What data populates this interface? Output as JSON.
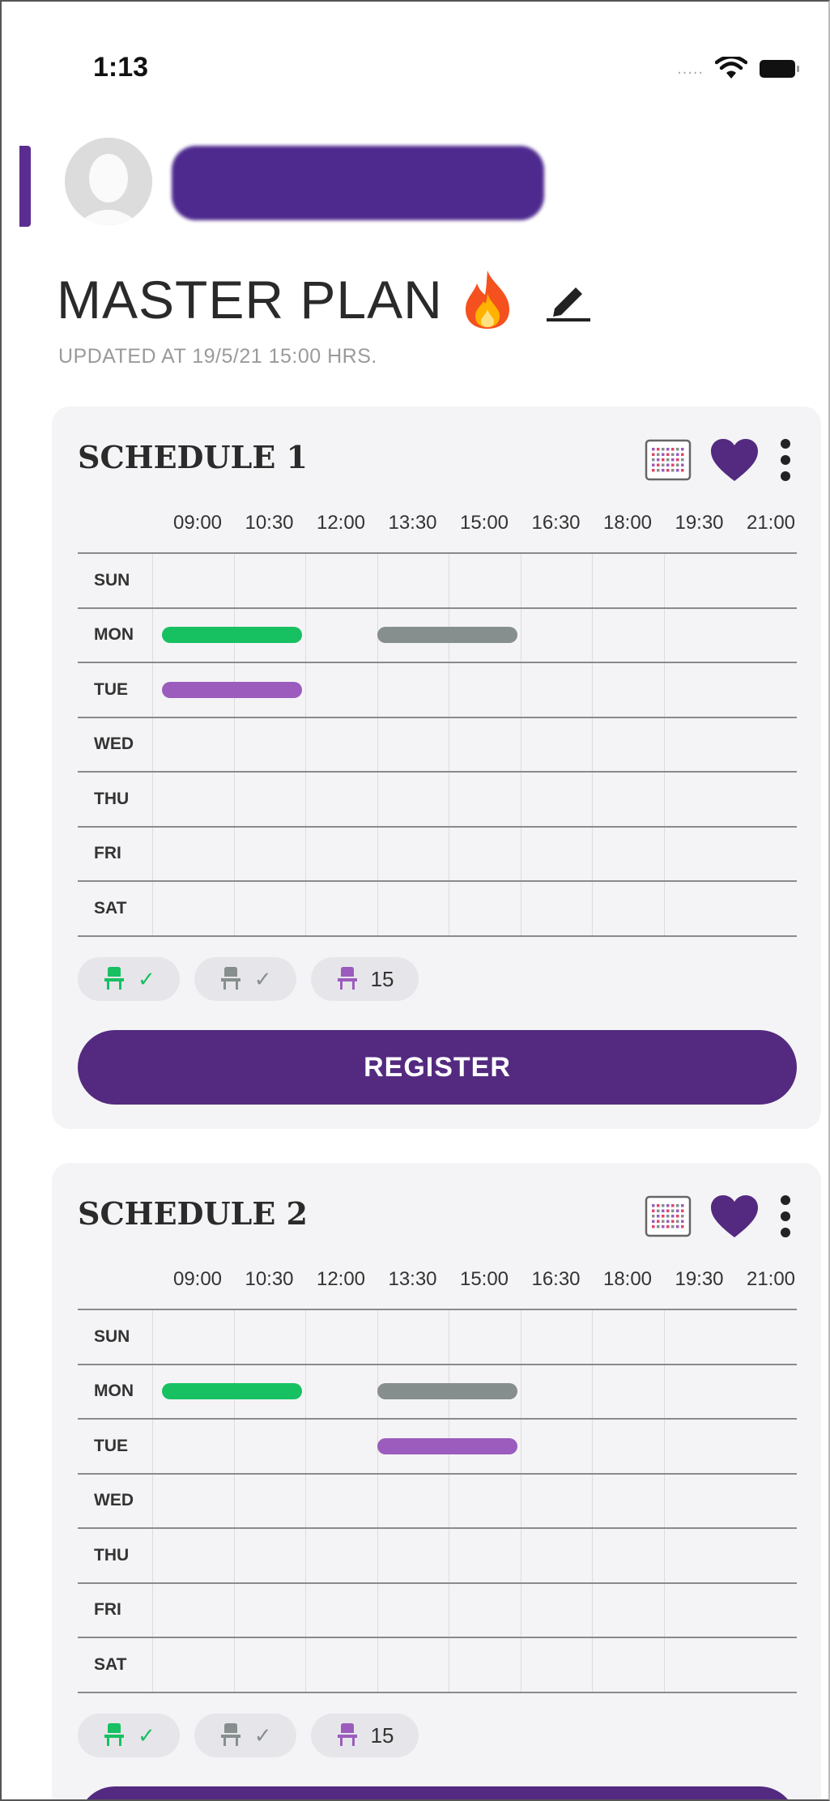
{
  "status_bar": {
    "time": "1:13",
    "signal": "....."
  },
  "profile": {
    "name": ""
  },
  "header": {
    "title": "MASTER PLAN",
    "updated": "UPDATED AT 19/5/21 15:00 HRS."
  },
  "grid": {
    "times": [
      "09:00",
      "10:30",
      "12:00",
      "13:30",
      "15:00",
      "16:30",
      "18:00",
      "19:30",
      "21:00"
    ],
    "days": [
      "SUN",
      "MON",
      "TUE",
      "WED",
      "THU",
      "FRI",
      "SAT"
    ]
  },
  "colors": {
    "accent": "#532a80",
    "green": "#17c061",
    "gray": "#878e8e",
    "purple": "#9b5cbd"
  },
  "legend": {
    "available_mark": "✓",
    "taken_mark": "✓",
    "seats_count": "15"
  },
  "register_label": "REGISTER",
  "schedules": [
    {
      "title": "SCHEDULE 1",
      "blocks": [
        {
          "day": "MON",
          "start": "09:00",
          "end": "12:00",
          "color": "green"
        },
        {
          "day": "MON",
          "start": "13:30",
          "end": "16:30",
          "color": "gray"
        },
        {
          "day": "TUE",
          "start": "09:00",
          "end": "12:00",
          "color": "purple"
        }
      ]
    },
    {
      "title": "SCHEDULE 2",
      "blocks": [
        {
          "day": "MON",
          "start": "09:00",
          "end": "12:00",
          "color": "green"
        },
        {
          "day": "MON",
          "start": "13:30",
          "end": "16:30",
          "color": "gray"
        },
        {
          "day": "TUE",
          "start": "13:30",
          "end": "16:30",
          "color": "purple"
        }
      ]
    }
  ]
}
